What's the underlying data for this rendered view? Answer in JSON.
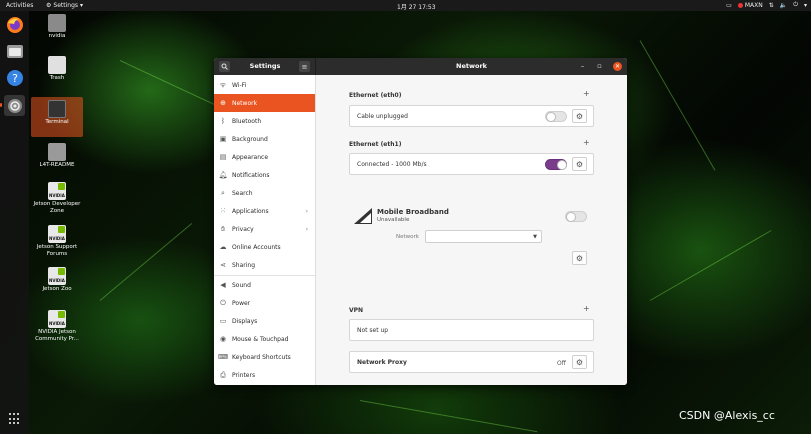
{
  "topbar": {
    "activities": "Activities",
    "app_menu": "Settings",
    "clock": "1月 27  17:53",
    "maxn": "MAXN"
  },
  "desktop": {
    "icons": [
      {
        "label": "nvidia"
      },
      {
        "label": "Trash"
      },
      {
        "label": "Terminal"
      },
      {
        "label": "L4T-README"
      },
      {
        "label": "Jetson Developer Zone"
      },
      {
        "label": "Jetson Support Forums"
      },
      {
        "label": "Jetson Zoo"
      },
      {
        "label": "NVIDIA Jetson Community Pr..."
      }
    ]
  },
  "window": {
    "sidebar_title": "Settings",
    "main_title": "Network",
    "sidebar": {
      "items": [
        {
          "label": "Wi-Fi",
          "icon": "wifi-icon"
        },
        {
          "label": "Network",
          "icon": "network-icon",
          "active": true
        },
        {
          "label": "Bluetooth",
          "icon": "bluetooth-icon"
        },
        {
          "label": "Background",
          "icon": "background-icon"
        },
        {
          "label": "Appearance",
          "icon": "appearance-icon"
        },
        {
          "label": "Notifications",
          "icon": "bell-icon"
        },
        {
          "label": "Search",
          "icon": "search-icon"
        },
        {
          "label": "Applications",
          "icon": "apps-icon",
          "chevron": "›"
        },
        {
          "label": "Privacy",
          "icon": "hand-icon",
          "chevron": "›"
        },
        {
          "label": "Online Accounts",
          "icon": "cloud-icon"
        },
        {
          "label": "Sharing",
          "icon": "share-icon"
        },
        {
          "label": "Sound",
          "icon": "speaker-icon"
        },
        {
          "label": "Power",
          "icon": "power-icon"
        },
        {
          "label": "Displays",
          "icon": "display-icon"
        },
        {
          "label": "Mouse & Touchpad",
          "icon": "mouse-icon"
        },
        {
          "label": "Keyboard Shortcuts",
          "icon": "keyboard-icon"
        },
        {
          "label": "Printers",
          "icon": "printer-icon"
        }
      ]
    },
    "network": {
      "eth0": {
        "title": "Ethernet (eth0)",
        "status": "Cable unplugged",
        "enabled": false
      },
      "eth1": {
        "title": "Ethernet (eth1)",
        "status": "Connected - 1000 Mb/s",
        "enabled": true
      },
      "mobile": {
        "title": "Mobile Broadband",
        "status": "Unavailable",
        "network_label": "Network",
        "enabled": false
      },
      "vpn": {
        "title": "VPN",
        "status": "Not set up"
      },
      "proxy": {
        "label": "Network Proxy",
        "state": "Off"
      }
    }
  },
  "watermark": "CSDN @Alexis_cc",
  "colors": {
    "accent": "#e95420",
    "toggle_on": "#7a3d8b",
    "titlebar": "#2c2c2c"
  }
}
